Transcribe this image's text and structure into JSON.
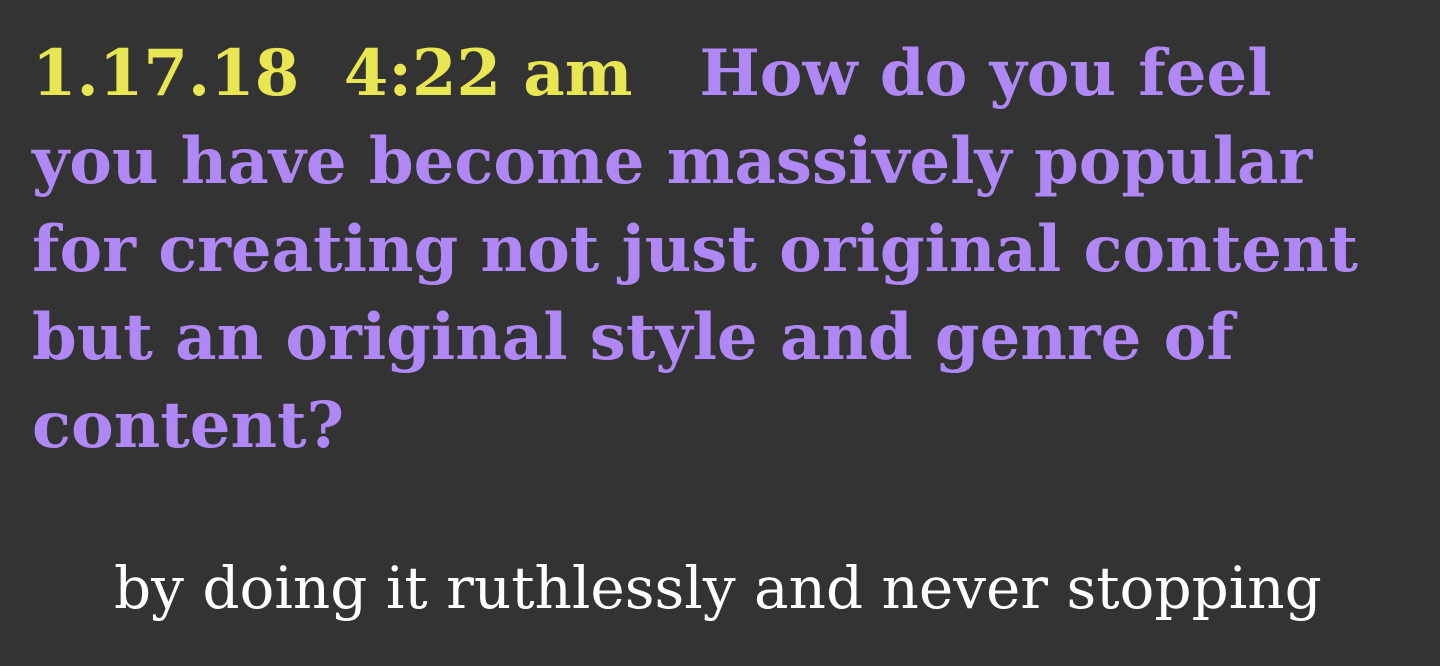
{
  "post": {
    "date": "1.17.18",
    "time": "4:22 am",
    "question": "How do you feel you have become massively popular for creating not just original content but an original style and genre of content?",
    "answer": "by doing it ruthlessly and never stopping"
  },
  "colors": {
    "background": "#333333",
    "timestamp": "#e9e654",
    "question": "#b088f5",
    "answer": "#ffffff"
  }
}
